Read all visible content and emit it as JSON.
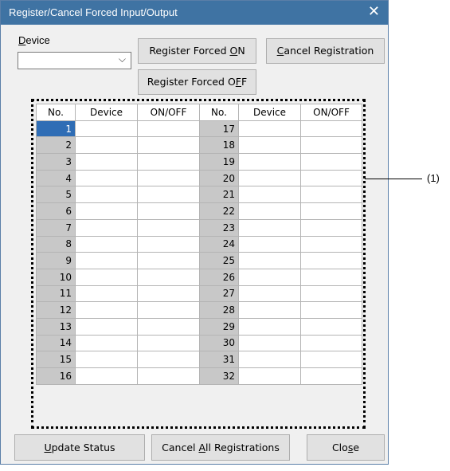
{
  "window": {
    "title": "Register/Cancel Forced Input/Output",
    "close_glyph": "✕"
  },
  "device_label_mnemonic": "D",
  "device_label_rest": "evice",
  "device_combo": {
    "value": "",
    "chevron": "⌵"
  },
  "buttons": {
    "register_on": {
      "pre": "Register Forced ",
      "mn": "O",
      "post": "N"
    },
    "cancel_registration": {
      "pre": "",
      "mn": "C",
      "post": "ancel Registration"
    },
    "register_off": {
      "pre": "Register Forced O",
      "mn": "F",
      "post": "F"
    },
    "update_status": {
      "pre": "",
      "mn": "U",
      "post": "pdate Status"
    },
    "cancel_all": {
      "pre": "Cancel ",
      "mn": "A",
      "post": "ll Registrations"
    },
    "close": {
      "pre": "Clo",
      "mn": "s",
      "post": "e"
    }
  },
  "grid": {
    "headers": [
      "No.",
      "Device",
      "ON/OFF",
      "No.",
      "Device",
      "ON/OFF"
    ],
    "left_numbers": [
      "1",
      "2",
      "3",
      "4",
      "5",
      "6",
      "7",
      "8",
      "9",
      "10",
      "11",
      "12",
      "13",
      "14",
      "15",
      "16"
    ],
    "right_numbers": [
      "17",
      "18",
      "19",
      "20",
      "21",
      "22",
      "23",
      "24",
      "25",
      "26",
      "27",
      "28",
      "29",
      "30",
      "31",
      "32"
    ]
  },
  "callout_label": "(1)",
  "colors": {
    "titlebar": "#3f73a3",
    "selected_row": "#2f6db5",
    "row_header": "#c8c8c8"
  }
}
